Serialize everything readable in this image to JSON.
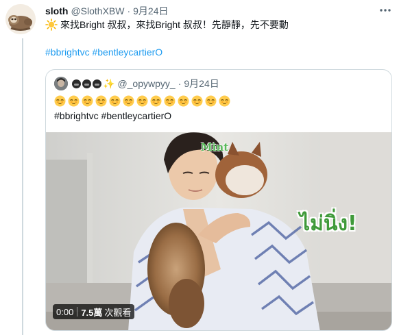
{
  "tweet": {
    "display_name": "sloth",
    "handle": "@SlothXBW",
    "separator": "·",
    "date": "9月24日",
    "text": "來找Bright 叔叔，來找Bright 叔叔！先靜靜，先不要動",
    "hashtags": [
      "#bbrightvc",
      "#bentleycartierO"
    ],
    "avatar_icon": "sloth-avatar",
    "emoji_icon": "sun-emoji",
    "more_icon": "more-icon"
  },
  "quote": {
    "emoji_suffix": "✨",
    "handle": "@_opywpyy_",
    "separator": "·",
    "date": "9月24日",
    "emoji_count": 13,
    "emoji_icon": "pleading-face-emoji",
    "hashtags": "#bbrightvc #bentleycartierO",
    "video": {
      "overlay_thai": "ไม่นิ่ง!",
      "overlay_mint": "Mint",
      "time": "0:00",
      "views": "7.5萬",
      "views_label": "次觀看"
    }
  },
  "colors": {
    "link": "#1d9bf0",
    "secondary_text": "#536471",
    "border": "#cfd9de",
    "overlay_green": "#3f9a3a"
  }
}
